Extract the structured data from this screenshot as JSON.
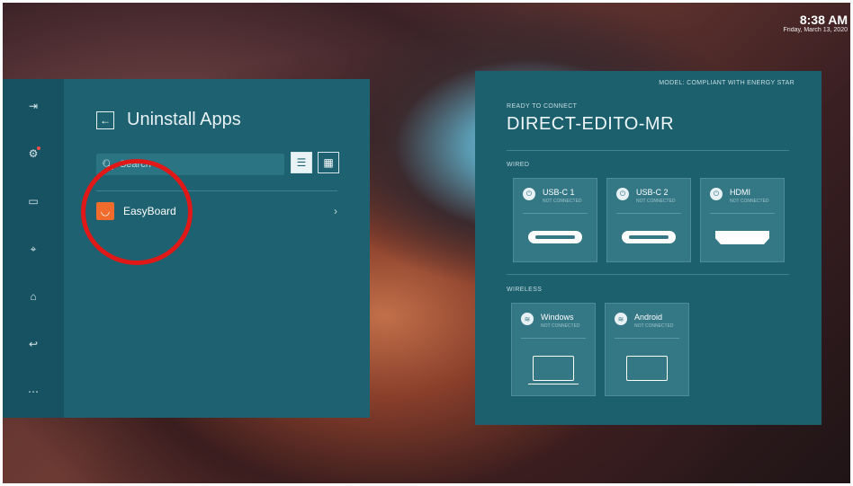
{
  "clock": {
    "time": "8:38 AM",
    "date": "Friday, March 13, 2020"
  },
  "left_panel": {
    "rail_icons": [
      "input-icon",
      "settings-icon",
      "whiteboard-icon",
      "screen-share-icon",
      "home-icon",
      "back-icon",
      "more-icon"
    ],
    "title": "Uninstall Apps",
    "search": {
      "placeholder": "Search"
    },
    "apps": [
      {
        "name": "EasyBoard",
        "icon": "easyboard-icon"
      }
    ]
  },
  "right_panel": {
    "model": "MODEL: COMPLIANT WITH ENERGY STAR",
    "ready": "READY TO CONNECT",
    "device_name": "DIRECT-EDITO-MR",
    "wired_label": "WIRED",
    "wired": [
      {
        "name": "USB-C 1",
        "status": "NOT CONNECTED",
        "icon": "usb-icon",
        "connector": "usb-c"
      },
      {
        "name": "USB-C 2",
        "status": "NOT CONNECTED",
        "icon": "usb-icon",
        "connector": "usb-c"
      },
      {
        "name": "HDMI",
        "status": "NOT CONNECTED",
        "icon": "hdmi-icon",
        "connector": "hdmi"
      }
    ],
    "wireless_label": "WIRELESS",
    "wireless": [
      {
        "name": "Windows",
        "status": "NOT CONNECTED",
        "icon": "wifi-icon",
        "device": "laptop"
      },
      {
        "name": "Android",
        "status": "NOT CONNECTED",
        "icon": "wifi-icon",
        "device": "tablet"
      }
    ]
  },
  "colors": {
    "annotation": "#e01818",
    "panel": "#1e6170",
    "app_accent": "#f06b2c"
  }
}
